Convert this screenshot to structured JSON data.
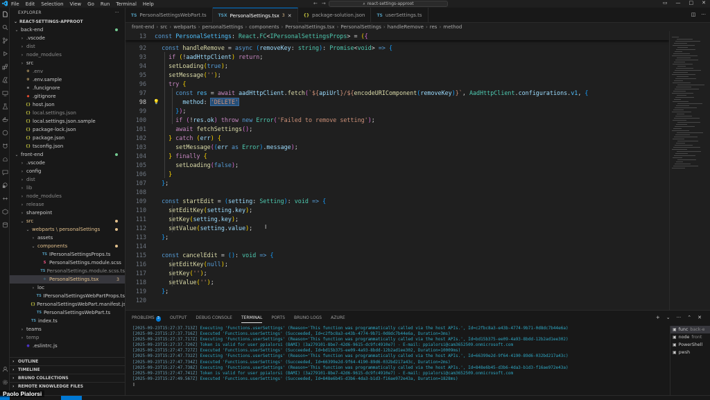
{
  "titlebar": {
    "menu": [
      "File",
      "Edit",
      "Selection",
      "View",
      "Go",
      "Run",
      "Terminal",
      "Help"
    ],
    "search_text": "react-settings-approot"
  },
  "explorer": {
    "header": "EXPLORER",
    "root": "REACT-SETTINGS-APPROOT",
    "tree": [
      {
        "label": "back-end",
        "depth": 0,
        "type": "folder-open",
        "color": "default",
        "dot": true
      },
      {
        "label": ".vscode",
        "depth": 1,
        "type": "folder",
        "color": "default"
      },
      {
        "label": "dist",
        "depth": 1,
        "type": "folder",
        "color": "ignored"
      },
      {
        "label": "node_modules",
        "depth": 1,
        "type": "folder",
        "color": "ignored"
      },
      {
        "label": "src",
        "depth": 1,
        "type": "folder",
        "color": "default"
      },
      {
        "label": ".env",
        "depth": 1,
        "type": "env",
        "color": "ignored"
      },
      {
        "label": ".env.sample",
        "depth": 1,
        "type": "env",
        "color": "default"
      },
      {
        "label": ".funcignore",
        "depth": 1,
        "type": "file",
        "color": "default"
      },
      {
        "label": ".gitignore",
        "depth": 1,
        "type": "git",
        "color": "default"
      },
      {
        "label": "host.json",
        "depth": 1,
        "type": "json",
        "color": "default"
      },
      {
        "label": "local.settings.json",
        "depth": 1,
        "type": "json",
        "color": "ignored"
      },
      {
        "label": "local.settings.json.sample",
        "depth": 1,
        "type": "json",
        "color": "default"
      },
      {
        "label": "package-lock.json",
        "depth": 1,
        "type": "json",
        "color": "default"
      },
      {
        "label": "package.json",
        "depth": 1,
        "type": "json",
        "color": "default"
      },
      {
        "label": "tsconfig.json",
        "depth": 1,
        "type": "json",
        "color": "default"
      },
      {
        "label": "front-end",
        "depth": 0,
        "type": "folder-open",
        "color": "default",
        "dot": true
      },
      {
        "label": ".vscode",
        "depth": 1,
        "type": "folder",
        "color": "default"
      },
      {
        "label": "config",
        "depth": 1,
        "type": "folder",
        "color": "default"
      },
      {
        "label": "dist",
        "depth": 1,
        "type": "folder",
        "color": "ignored"
      },
      {
        "label": "lib",
        "depth": 1,
        "type": "folder",
        "color": "ignored"
      },
      {
        "label": "node_modules",
        "depth": 1,
        "type": "folder",
        "color": "ignored"
      },
      {
        "label": "release",
        "depth": 1,
        "type": "folder",
        "color": "ignored"
      },
      {
        "label": "sharepoint",
        "depth": 1,
        "type": "folder",
        "color": "default"
      },
      {
        "label": "src",
        "depth": 1,
        "type": "folder-open",
        "color": "modified",
        "dot": true
      },
      {
        "label": "webparts \\ personalSettings",
        "depth": 2,
        "type": "folder-open",
        "color": "modified",
        "dot": true
      },
      {
        "label": "assets",
        "depth": 3,
        "type": "folder",
        "color": "default"
      },
      {
        "label": "components",
        "depth": 3,
        "type": "folder-open",
        "color": "modified",
        "dot": true
      },
      {
        "label": "IPersonalSettingsProps.ts",
        "depth": 4,
        "type": "ts",
        "color": "default"
      },
      {
        "label": "PersonalSettings.module.scss",
        "depth": 4,
        "type": "scss",
        "color": "default"
      },
      {
        "label": "PersonalSettings.module.scss.ts",
        "depth": 4,
        "type": "ts",
        "color": "ignored"
      },
      {
        "label": "PersonalSettings.tsx",
        "depth": 4,
        "type": "tsx",
        "color": "modified",
        "badge": "3",
        "selected": true
      },
      {
        "label": "loc",
        "depth": 3,
        "type": "folder",
        "color": "default"
      },
      {
        "label": "IPersonalSettingsWebPartProps.ts",
        "depth": 3,
        "type": "ts",
        "color": "default"
      },
      {
        "label": "PersonalSettingsWebPart.manifest.json",
        "depth": 3,
        "type": "json",
        "color": "default"
      },
      {
        "label": "PersonalSettingsWebPart.ts",
        "depth": 3,
        "type": "ts",
        "color": "default"
      },
      {
        "label": "index.ts",
        "depth": 2,
        "type": "ts",
        "color": "default"
      },
      {
        "label": "teams",
        "depth": 1,
        "type": "folder",
        "color": "default"
      },
      {
        "label": "temp",
        "depth": 1,
        "type": "folder",
        "color": "ignored"
      },
      {
        "label": ".eslintrc.js",
        "depth": 1,
        "type": "eslint",
        "color": "default"
      }
    ],
    "sections": [
      "OUTLINE",
      "TIMELINE",
      "BRUNO COLLECTIONS",
      "REMOTE KNOWLEDGE FILES"
    ]
  },
  "tabs": [
    {
      "label": "PersonalSettingsWebPart.ts",
      "icon": "TS",
      "active": false
    },
    {
      "label": "PersonalSettings.tsx",
      "icon": "TSX",
      "badge": "3",
      "active": true
    },
    {
      "label": "package-solution.json",
      "icon": "{}",
      "active": false
    },
    {
      "label": "userSettings.ts",
      "icon": "TS",
      "active": false
    }
  ],
  "breadcrumb": [
    "front-end",
    "src",
    "webparts",
    "personalSettings",
    "components",
    "PersonalSettings.tsx",
    "PersonalSettings",
    "handleRemove",
    "res",
    "method"
  ],
  "editor": {
    "sticky_line": {
      "num": "13",
      "html": "<span class='k'>const</span> <span class='c'>PersonalSettings</span><span class='p'>: </span><span class='t'>React</span><span class='p'>.</span><span class='t'>FC</span><span class='p'>&lt;</span><span class='t'>IPersonalSettingsProps</span><span class='p'>&gt; = </span><span class='b1'>(</span><span class='b2'>{</span>"
    },
    "lines": [
      {
        "num": "92",
        "html": "  <span class='k'>const</span> <span class='f'>handleRemove</span> = <span class='k'>async</span> <span class='b3'>(</span><span class='v'>removeKey</span>: <span class='t'>string</span><span class='b3'>)</span>: <span class='t'>Promise</span>&lt;<span class='t'>void</span>&gt; <span class='k'>=&gt;</span> <span class='b3'>{</span>"
      },
      {
        "num": "93",
        "html": "    <span class='kc'>if</span> <span class='b1'>(</span>!<span class='v'>aadHttpClient</span><span class='b1'>)</span> <span class='kc'>return</span>;"
      },
      {
        "num": "94",
        "html": "    <span class='f'>setLoading</span><span class='b1'>(</span><span class='k'>true</span><span class='b1'>)</span>;"
      },
      {
        "num": "95",
        "html": "    <span class='f'>setMessage</span><span class='b1'>(</span><span class='s'>''</span><span class='b1'>)</span>;"
      },
      {
        "num": "96",
        "html": "    <span class='kc'>try</span> <span class='b1'>{</span>"
      },
      {
        "num": "97",
        "html": "      <span class='k'>const</span> <span class='c'>res</span> = <span class='kc'>await</span> <span class='v'>aadHttpClient</span>.<span class='f'>fetch</span><span class='b2'>(</span><span class='s'>`${</span><span class='v'>apiUrl</span><span class='s'>}/${</span><span class='f'>encodeURIComponent</span><span class='b3'>(</span><span class='v'>removeKey</span><span class='b3'>)</span><span class='s'>}`</span>, <span class='t'>AadHttpClient</span>.<span class='v'>configurations</span>.<span class='c'>v1</span>, <span class='b3'>{</span>"
      },
      {
        "num": "98",
        "current": true,
        "html": "        <span class='v'>method</span>: <span class='s sel'>'DELETE'</span>"
      },
      {
        "num": "99",
        "html": "      <span class='b3'>}</span><span class='b2'>)</span>;"
      },
      {
        "num": "100",
        "html": "      <span class='kc'>if</span> <span class='b2'>(</span>!<span class='v'>res</span>.<span class='v'>ok</span><span class='b2'>)</span> <span class='kc'>throw</span> <span class='k'>new</span> <span class='t'>Error</span><span class='b2'>(</span><span class='s'>'Failed to remove setting'</span><span class='b2'>)</span>;"
      },
      {
        "num": "101",
        "html": "      <span class='kc'>await</span> <span class='f'>fetchSettings</span><span class='b2'>()</span>;"
      },
      {
        "num": "102",
        "html": "    <span class='b1'>}</span> <span class='kc'>catch</span> <span class='b1'>(</span><span class='v'>err</span><span class='b1'>)</span> <span class='b1'>{</span>"
      },
      {
        "num": "103",
        "html": "      <span class='f'>setMessage</span><span class='b2'>(</span><span class='b3'>(</span><span class='v'>err</span> <span class='k'>as</span> <span class='t'>Error</span><span class='b3'>)</span>.<span class='v'>message</span><span class='b2'>)</span>;"
      },
      {
        "num": "104",
        "html": "    <span class='b1'>}</span> <span class='kc'>finally</span> <span class='b1'>{</span>"
      },
      {
        "num": "105",
        "html": "      <span class='f'>setLoading</span><span class='b2'>(</span><span class='k'>false</span><span class='b2'>)</span>;"
      },
      {
        "num": "106",
        "html": "    <span class='b1'>}</span>"
      },
      {
        "num": "107",
        "html": "  <span class='b3'>}</span>;"
      },
      {
        "num": "108",
        "html": ""
      },
      {
        "num": "109",
        "html": "  <span class='k'>const</span> <span class='f'>startEdit</span> = <span class='b3'>(</span><span class='v'>setting</span>: <span class='t'>Setting</span><span class='b3'>)</span>: <span class='t'>void</span> <span class='k'>=&gt;</span> <span class='b3'>{</span>"
      },
      {
        "num": "110",
        "html": "    <span class='f'>setEditKey</span><span class='b1'>(</span><span class='v'>setting</span>.<span class='v'>key</span><span class='b1'>)</span>;"
      },
      {
        "num": "111",
        "html": "    <span class='f'>setKey</span><span class='b1'>(</span><span class='v'>setting</span>.<span class='v'>key</span><span class='b1'>)</span>;"
      },
      {
        "num": "112",
        "html": "    <span class='f'>setValue</span><span class='b1'>(</span><span class='v'>setting</span>.<span class='v'>value</span><span class='b1'>)</span>;"
      },
      {
        "num": "113",
        "html": "  <span class='b3'>}</span>;"
      },
      {
        "num": "114",
        "html": ""
      },
      {
        "num": "115",
        "html": "  <span class='k'>const</span> <span class='f'>cancelEdit</span> = <span class='b3'>()</span>: <span class='t'>void</span> <span class='k'>=&gt;</span> <span class='b3'>{</span>"
      },
      {
        "num": "116",
        "html": "    <span class='f'>setEditKey</span><span class='b1'>(</span><span class='k'>null</span><span class='b1'>)</span>;"
      },
      {
        "num": "117",
        "html": "    <span class='f'>setKey</span><span class='b1'>(</span><span class='s'>''</span><span class='b1'>)</span>;"
      },
      {
        "num": "118",
        "html": "    <span class='f'>setValue</span><span class='b1'>(</span><span class='s'>''</span><span class='b1'>)</span>;"
      },
      {
        "num": "119",
        "html": "  <span class='b3'>}</span>;"
      },
      {
        "num": "120",
        "html": ""
      }
    ]
  },
  "panel": {
    "tabs": [
      {
        "label": "PROBLEMS",
        "badge": "3"
      },
      {
        "label": "OUTPUT"
      },
      {
        "label": "DEBUG CONSOLE"
      },
      {
        "label": "TERMINAL",
        "active": true
      },
      {
        "label": "PORTS"
      },
      {
        "label": "BRUNO LOGS"
      },
      {
        "label": "AZURE"
      }
    ],
    "terminal_lines": [
      {
        "ts": "[2025-09-23T15:27:37.713Z]",
        "msg": "Executing 'Functions.userSettings' (Reason='This function was programmatically called via the host APIs.', Id=c2fbc8a3-e43b-4774-9b71-0d8dc7b44e6a)"
      },
      {
        "ts": "[2025-09-23T15:27:37.716Z]",
        "msg": "Executed 'Functions.userSettings' (Succeeded, Id=c2fbc8a3-e43b-4774-9b71-0d8dc7b44e6a, Duration=3ms)"
      },
      {
        "ts": "[2025-09-23T15:27:37.717Z]",
        "msg": "Executing 'Functions.userSettings' (Reason='This function was programmatically called via the host APIs.', Id=bd15b375-ee09-4a93-8bdd-12b2ad1ee302)"
      },
      {
        "ts": "[2025-09-23T15:27:37.720Z]",
        "msg": "Token is valid for user ppialorsi (BAMI) (3a279101-8be7-42d6-9615-dc9fc4910e7) - E-mail: ppialorsi@cam3652509.onmicrosoft.com"
      },
      {
        "ts": "[2025-09-23T15:27:47.727Z]",
        "msg": "Executed 'Functions.userSettings' (Succeeded, Id=bd15b375-ee09-4a93-8bdd-12b2ad1ee302, Duration=10009ms)"
      },
      {
        "ts": "[2025-09-23T15:27:47.732Z]",
        "msg": "Executing 'Functions.userSettings' (Reason='This function was programmatically called via the host APIs.', Id=66399e2d-9f64-4190-89d6-032bd217a43c)"
      },
      {
        "ts": "[2025-09-23T15:27:47.734Z]",
        "msg": "Executed 'Functions.userSettings' (Succeeded, Id=66399e2d-9f64-4190-89d6-032bd217a43c, Duration=2ms)"
      },
      {
        "ts": "[2025-09-23T15:27:47.738Z]",
        "msg": "Executing 'Functions.userSettings' (Reason='This function was programmatically called via the host APIs.', Id=848e6b45-d3b6-4da3-b1d3-f16ae972e43a)"
      },
      {
        "ts": "[2025-09-23T15:27:47.741Z]",
        "msg": "Token is valid for user ppialorsi (BAMI) (3a279101-8be7-42d6-9615-dc9fc4910e7) - E-mail: ppialorsi@cam3652509.onmicrosoft.com"
      },
      {
        "ts": "[2025-09-23T15:27:49.567Z]",
        "msg": "Executed 'Functions.userSettings' (Succeeded, Id=848e6b45-d3b6-4da3-b1d3-f16ae972e43a, Duration=1828ms)"
      }
    ],
    "terminal_list": [
      {
        "label": "func",
        "dim": "back-e",
        "active": true
      },
      {
        "label": "node",
        "dim": "front"
      },
      {
        "label": "PowerShell",
        "dim": ""
      },
      {
        "label": "pwsh",
        "dim": ""
      }
    ]
  },
  "caption": "Paolo Pialorsi",
  "colors": {
    "accent": "#0078d4",
    "modified": "#e2c08d",
    "untracked": "#73c991"
  }
}
